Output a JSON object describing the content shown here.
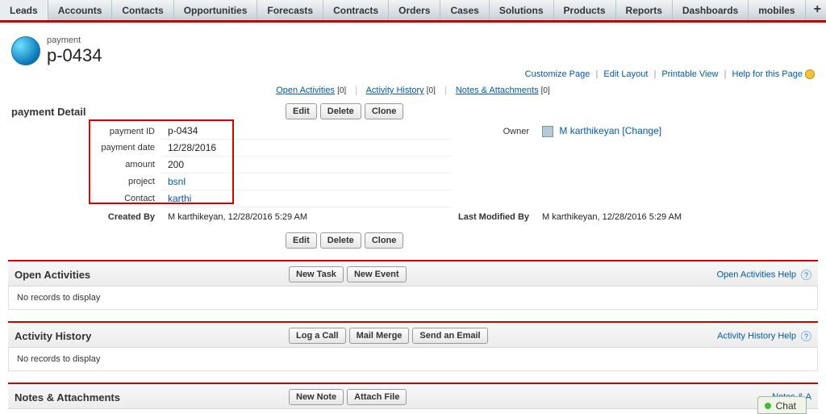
{
  "nav": {
    "items": [
      "Leads",
      "Accounts",
      "Contacts",
      "Opportunities",
      "Forecasts",
      "Contracts",
      "Orders",
      "Cases",
      "Solutions",
      "Products",
      "Reports",
      "Dashboards",
      "mobiles"
    ]
  },
  "page_links": {
    "customize": "Customize Page",
    "edit_layout": "Edit Layout",
    "printable": "Printable View",
    "help": "Help for this Page"
  },
  "title": {
    "object": "payment",
    "name": "p-0434"
  },
  "rel_links": [
    {
      "label": "Open Activities",
      "count": "[0]"
    },
    {
      "label": "Activity History",
      "count": "[0]"
    },
    {
      "label": "Notes & Attachments",
      "count": "[0]"
    }
  ],
  "section": {
    "detail_title": "payment Detail",
    "buttons": {
      "edit": "Edit",
      "delete": "Delete",
      "clone": "Clone"
    }
  },
  "fields": {
    "payment_id": {
      "label": "payment ID",
      "value": "p-0434"
    },
    "payment_date": {
      "label": "payment date",
      "value": "12/28/2016"
    },
    "amount": {
      "label": "amount",
      "value": "200"
    },
    "project": {
      "label": "project",
      "value": "bsnl"
    },
    "contact": {
      "label": "Contact",
      "value": "karthi"
    },
    "owner": {
      "label": "Owner",
      "value": "M karthikeyan",
      "change": "[Change]"
    },
    "created_by": {
      "label": "Created By",
      "value": "M karthikeyan, 12/28/2016 5:29 AM"
    },
    "last_modified_by": {
      "label": "Last Modified By",
      "value": "M karthikeyan, 12/28/2016 5:29 AM"
    }
  },
  "related_lists": {
    "open_activities": {
      "title": "Open Activities",
      "buttons": {
        "new_task": "New Task",
        "new_event": "New Event"
      },
      "help": "Open Activities Help",
      "body": "No records to display"
    },
    "activity_history": {
      "title": "Activity History",
      "buttons": {
        "log_call": "Log a Call",
        "mail_merge": "Mail Merge",
        "send_email": "Send an Email"
      },
      "help": "Activity History Help",
      "body": "No records to display"
    },
    "notes": {
      "title": "Notes & Attachments",
      "buttons": {
        "new_note": "New Note",
        "attach_file": "Attach File"
      },
      "help": "Notes & A"
    }
  },
  "chat": {
    "label": "Chat"
  }
}
